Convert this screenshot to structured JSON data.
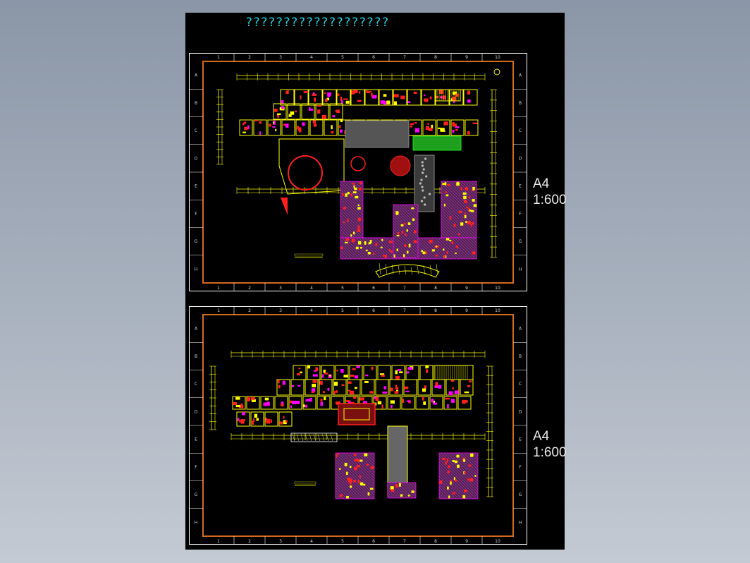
{
  "app": {
    "title": "???????????????????"
  },
  "sheets": [
    {
      "scale_line1": "A4",
      "scale_line2": "1:600",
      "grid_cols": [
        "1",
        "2",
        "3",
        "4",
        "5",
        "6",
        "7",
        "8",
        "9",
        "10"
      ],
      "grid_rows": [
        "A",
        "B",
        "C",
        "D",
        "E",
        "F",
        "G",
        "H"
      ]
    },
    {
      "scale_line1": "A4",
      "scale_line2": "1:600",
      "grid_cols": [
        "1",
        "2",
        "3",
        "4",
        "5",
        "6",
        "7",
        "8",
        "9",
        "10"
      ],
      "grid_rows": [
        "A",
        "B",
        "C",
        "D",
        "E",
        "F",
        "G",
        "H"
      ]
    }
  ],
  "colors": {
    "background_top": "#8b96a7",
    "background_bottom": "#c4cad3",
    "drawing_bg": "#000000",
    "title_text": "#19d3df",
    "frame_outer": "#ffffff",
    "frame_inner": "#d46a1e",
    "cad_yellow": "#ffff00",
    "cad_magenta": "#ff00ff",
    "cad_red": "#ff2020",
    "cad_green": "#20e020",
    "cad_grey": "#888888"
  }
}
